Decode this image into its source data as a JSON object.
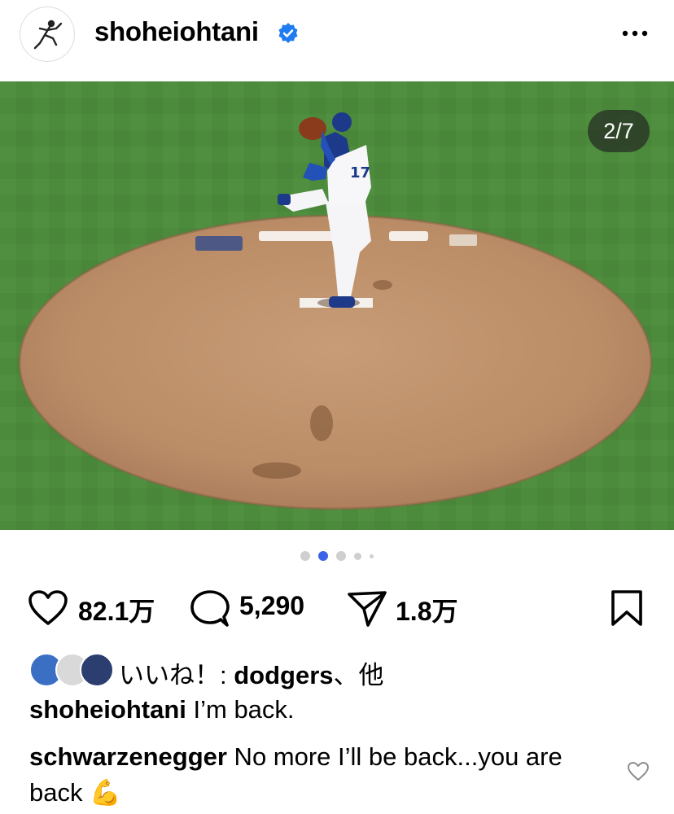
{
  "post": {
    "username": "shoheiohtani",
    "verified": true,
    "media_counter": "2/7",
    "carousel": {
      "total_dots": 5,
      "active_index": 1
    },
    "actions": {
      "likes": "82.1万",
      "comments": "5,290",
      "shares": "1.8万"
    },
    "liked_by": {
      "prefix": "いいね！: ",
      "user": "dodgers",
      "suffix": "、他"
    },
    "caption": {
      "user": "shoheiohtani",
      "text": " I’m back."
    },
    "top_comment": {
      "user": "schwarzenegger",
      "text": " No more I’ll be back...you are back 💪"
    }
  },
  "icons": [
    "verified-badge-icon",
    "more-options-icon",
    "heart-icon",
    "comment-icon",
    "share-icon",
    "bookmark-icon",
    "comment-like-heart-icon"
  ],
  "colors": {
    "accent": "#3b63e8",
    "verified": "#1f7bf2",
    "counter_bg": "#202020"
  }
}
